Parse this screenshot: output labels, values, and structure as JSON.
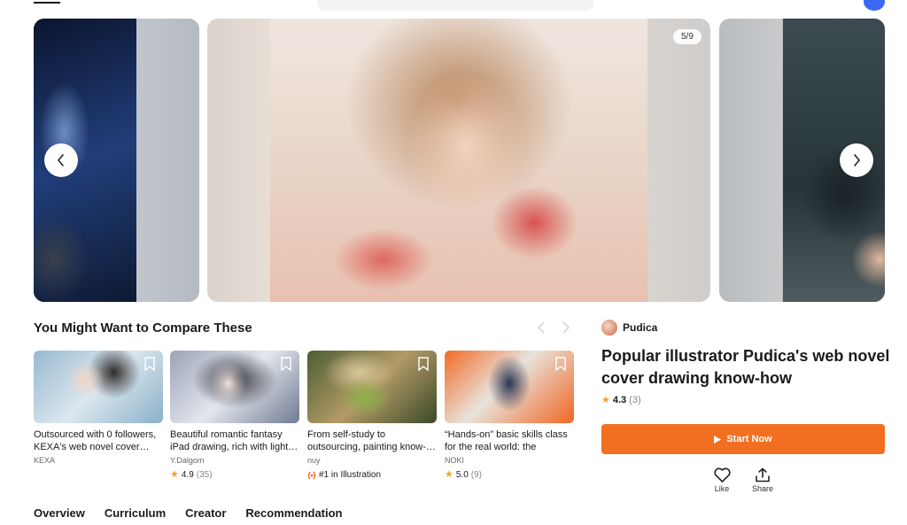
{
  "carousel": {
    "counter": "5/9"
  },
  "compare": {
    "title": "You Might Want to Compare These",
    "cards": [
      {
        "title": "Outsourced with 0 followers, KEXA's web novel cover…",
        "author": "KEXA",
        "rating": null,
        "rating_count": null,
        "badge": null
      },
      {
        "title": "Beautiful romantic fantasy iPad drawing, rich with light…",
        "author": "Y.Dalgom",
        "rating": "4.9",
        "rating_count": "(35)",
        "badge": null
      },
      {
        "title": "From self-study to outsourcing, painting know-…",
        "author": "nuy",
        "rating": null,
        "rating_count": null,
        "badge": "#1 in Illustration"
      },
      {
        "title": "“Hands-on” basic skills class for the real world: the secret…",
        "author": "NOKI",
        "rating": "5.0",
        "rating_count": "(9)",
        "badge": null
      }
    ]
  },
  "tabs": [
    "Overview",
    "Curriculum",
    "Creator",
    "Recommendation"
  ],
  "product": {
    "creator": "Pudica",
    "title": "Popular illustrator Pudica's web novel cover drawing know-how",
    "rating": "4.3",
    "rating_count": "(3)",
    "cta": "Start Now",
    "like_label": "Like",
    "share_label": "Share"
  },
  "colors": {
    "accent": "#f26f21",
    "star": "#f3a41d"
  }
}
